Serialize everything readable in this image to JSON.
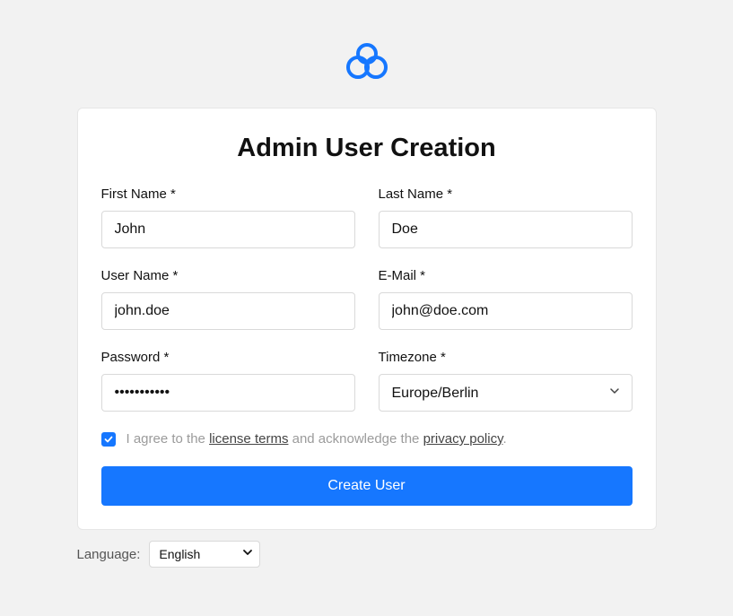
{
  "title": "Admin User Creation",
  "fields": {
    "firstName": {
      "label": "First Name *",
      "value": "John"
    },
    "lastName": {
      "label": "Last Name *",
      "value": "Doe"
    },
    "userName": {
      "label": "User Name *",
      "value": "john.doe"
    },
    "email": {
      "label": "E-Mail *",
      "value": "john@doe.com"
    },
    "password": {
      "label": "Password *",
      "value": "•••••••••••"
    },
    "timezone": {
      "label": "Timezone *",
      "value": "Europe/Berlin"
    }
  },
  "agreement": {
    "checked": true,
    "prefix": "I agree to the ",
    "licenseTerms": "license terms",
    "middle": " and acknowledge the ",
    "privacyPolicy": "privacy policy",
    "suffix": "."
  },
  "submitLabel": "Create User",
  "language": {
    "label": "Language:",
    "value": "English"
  }
}
